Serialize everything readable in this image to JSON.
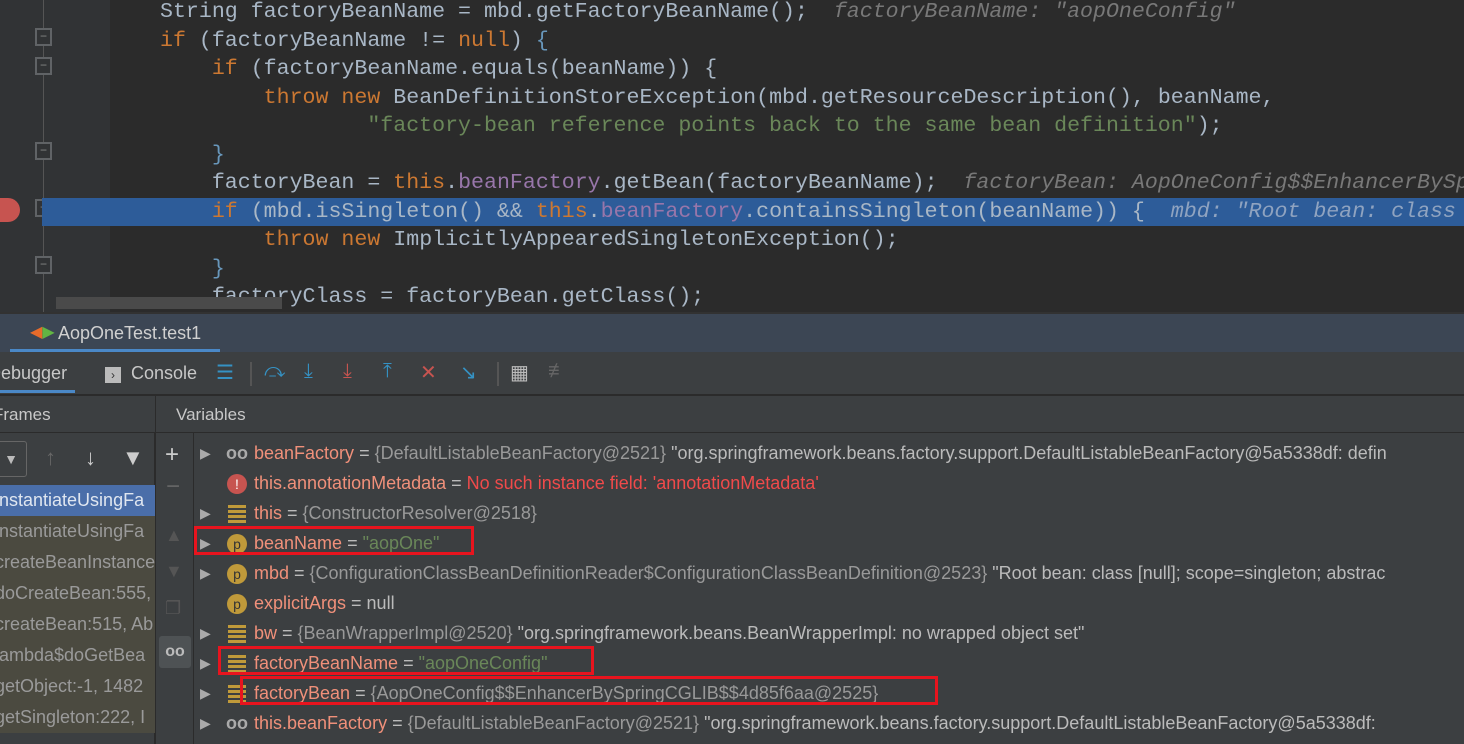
{
  "editor": {
    "lines": [
      [
        [
          "String factoryBeanName = mbd.getFactoryBeanName();",
          ""
        ],
        [
          "  factoryBeanName: \"aopOneConfig\"",
          "hint"
        ]
      ],
      [
        [
          "if",
          "kw"
        ],
        [
          " (factoryBeanName != ",
          ""
        ],
        [
          "null",
          "kw"
        ],
        [
          ") ",
          ""
        ],
        [
          "{",
          "br"
        ]
      ],
      [
        [
          "    ",
          ""
        ],
        [
          "if",
          "kw"
        ],
        [
          " (factoryBeanName.equals(beanName)) {",
          ""
        ]
      ],
      [
        [
          "        ",
          ""
        ],
        [
          "throw new",
          "kw"
        ],
        [
          " BeanDefinitionStoreException(mbd.getResourceDescription(), beanName,",
          ""
        ]
      ],
      [
        [
          "                ",
          ""
        ],
        [
          "\"factory-bean reference points back to the same bean definition\"",
          "str"
        ],
        [
          ");",
          ""
        ]
      ],
      [
        [
          "    ",
          ""
        ],
        [
          "}",
          "br"
        ]
      ],
      [
        [
          "    factoryBean = ",
          ""
        ],
        [
          "this",
          "kw"
        ],
        [
          ".",
          ""
        ],
        [
          "beanFactory",
          "fld"
        ],
        [
          ".getBean(factoryBeanName);",
          ""
        ],
        [
          "  factoryBean: AopOneConfig$$EnhancerBySpringCGLIB",
          "hint"
        ]
      ],
      [
        [
          "    ",
          ""
        ],
        [
          "if",
          "kw"
        ],
        [
          " (mbd.isSingleton() && ",
          ""
        ],
        [
          "this",
          "kw"
        ],
        [
          ".",
          ""
        ],
        [
          "beanFactory",
          "fld"
        ],
        [
          ".containsSingleton(beanName)) {",
          ""
        ],
        [
          "  mbd: \"Root bean: class [null]",
          "hlhint"
        ]
      ],
      [
        [
          "        ",
          ""
        ],
        [
          "throw new",
          "kw"
        ],
        [
          " ImplicitlyAppearedSingletonException();",
          ""
        ]
      ],
      [
        [
          "    ",
          ""
        ],
        [
          "}",
          "br"
        ]
      ],
      [
        [
          "    factoryClass = factoryBean.getClass();",
          ""
        ]
      ]
    ],
    "highlighted_line": 7
  },
  "run_tab": {
    "label": "AopOneTest.test1",
    "close": "×"
  },
  "toolbar": {
    "debugger": "Debugger",
    "console": "Console",
    "icons": [
      "restore-layout-icon",
      "step-over-icon",
      "step-into-icon",
      "force-step-into-icon",
      "step-out-icon",
      "drop-frame-icon",
      "run-to-cursor-icon",
      "evaluate-expression-icon",
      "trace-icon"
    ]
  },
  "panels": {
    "frames": "Frames",
    "variables": "Variables"
  },
  "frames": [
    "instantiateUsingFa",
    "instantiateUsingFa",
    "createBeanInstance",
    "doCreateBean:555,",
    "createBean:515, Ab",
    "lambda$doGetBea",
    "getObject:-1, 1482",
    "getSingleton:222, I"
  ],
  "variables": [
    {
      "icon": "watch",
      "name": "beanFactory",
      "ref": "{DefaultListableBeanFactory@2521}",
      "value": "\"org.springframework.beans.factory.support.DefaultListableBeanFactory@5a5338df: defin",
      "expandable": true
    },
    {
      "icon": "error",
      "name": "this.annotationMetadata",
      "error": "No such instance field: 'annotationMetadata'",
      "expandable": false
    },
    {
      "icon": "field",
      "name": "this",
      "ref": "{ConstructorResolver@2518}",
      "expandable": true
    },
    {
      "icon": "param",
      "name": "beanName",
      "str": "\"aopOne\"",
      "expandable": true,
      "boxed": true
    },
    {
      "icon": "param",
      "name": "mbd",
      "ref": "{ConfigurationClassBeanDefinitionReader$ConfigurationClassBeanDefinition@2523}",
      "value": "\"Root bean: class [null]; scope=singleton; abstrac",
      "expandable": true
    },
    {
      "icon": "param",
      "name": "explicitArgs",
      "value": "null",
      "expandable": false
    },
    {
      "icon": "field",
      "name": "bw",
      "ref": "{BeanWrapperImpl@2520}",
      "value": "\"org.springframework.beans.BeanWrapperImpl: no wrapped object set\"",
      "expandable": true
    },
    {
      "icon": "field",
      "name": "factoryBeanName",
      "str": "\"aopOneConfig\"",
      "expandable": true,
      "boxed": true
    },
    {
      "icon": "field",
      "name": "factoryBean",
      "ref": "{AopOneConfig$$EnhancerBySpringCGLIB$$4d85f6aa@2525}",
      "expandable": true,
      "boxed": true
    },
    {
      "icon": "watch",
      "name": "this.beanFactory",
      "ref": "{DefaultListableBeanFactory@2521}",
      "value": "\"org.springframework.beans.factory.support.DefaultListableBeanFactory@5a5338df: ",
      "expandable": true
    }
  ],
  "colors": {
    "highlight": "#2d5c99",
    "annotation_box": "#e8141e",
    "selected_frame": "#4a6ea9"
  }
}
